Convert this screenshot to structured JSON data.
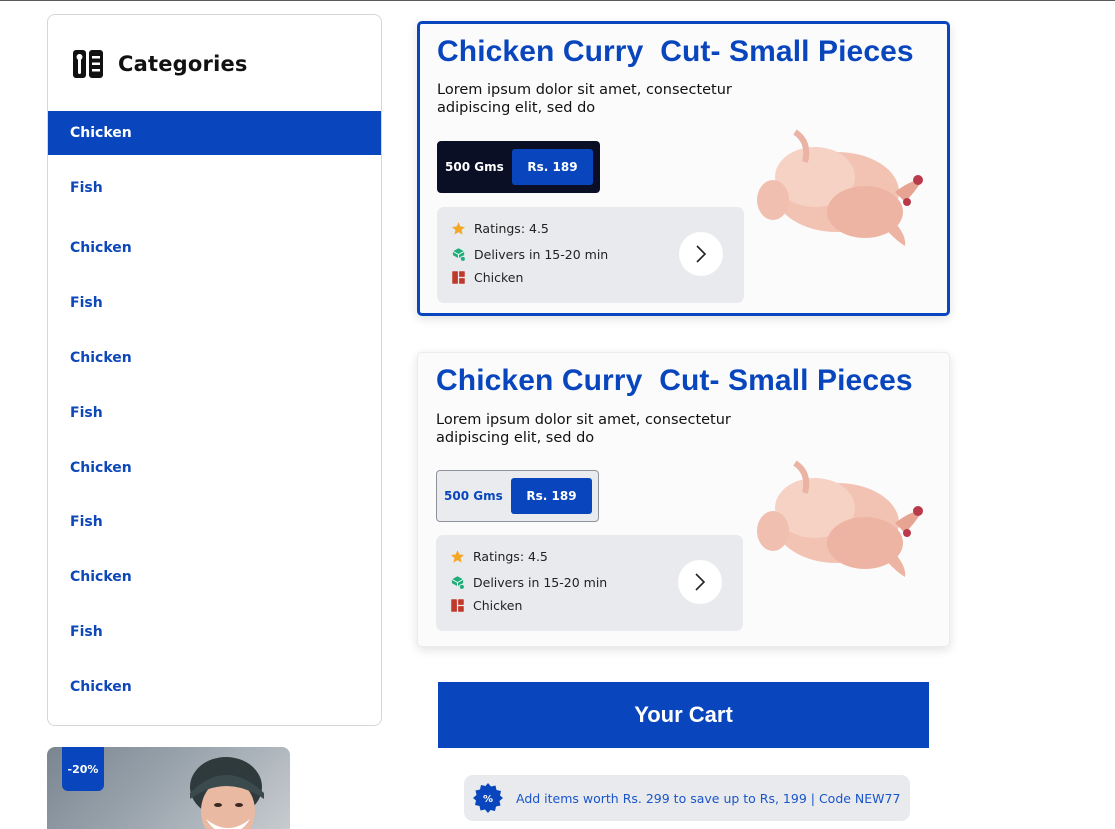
{
  "sidebar": {
    "title": "Categories",
    "items": [
      {
        "label": "Chicken"
      },
      {
        "label": "Fish"
      },
      {
        "label": "Chicken"
      },
      {
        "label": "Fish"
      },
      {
        "label": "Chicken"
      },
      {
        "label": "Fish"
      },
      {
        "label": "Chicken"
      },
      {
        "label": "Fish"
      },
      {
        "label": "Chicken"
      },
      {
        "label": "Fish"
      },
      {
        "label": "Chicken"
      }
    ]
  },
  "promo": {
    "discount": "-20%"
  },
  "products": [
    {
      "title": "Chicken Curry  Cut- Small Pieces",
      "description": "Lorem ipsum dolor sit amet, consectetur adipiscing elit, sed do",
      "weight": "500 Gms",
      "price": "Rs. 189",
      "rating": "Ratings: 4.5",
      "delivery": "Delivers in 15-20 min",
      "category": "Chicken"
    },
    {
      "title": "Chicken Curry  Cut- Small Pieces",
      "description": "Lorem ipsum dolor sit amet, consectetur adipiscing elit, sed do",
      "weight": "500 Gms",
      "price": "Rs. 189",
      "rating": "Ratings: 4.5",
      "delivery": "Delivers in 15-20 min",
      "category": "Chicken"
    }
  ],
  "cart": {
    "label": "Your Cart"
  },
  "offer": {
    "text": "Add items worth Rs. 299 to save up to Rs, 199 | Code NEW77"
  },
  "colors": {
    "primary": "#0946bd",
    "dark": "#0b0f26",
    "star": "#f5a623",
    "delivery": "#1fae7a",
    "category": "#c0392b"
  },
  "icons": {
    "categories": "menu-book-icon",
    "rating": "star-icon",
    "delivery": "cube-icon",
    "category": "category-icon",
    "arrow": "chevron-right-icon",
    "offer": "discount-badge-icon"
  }
}
